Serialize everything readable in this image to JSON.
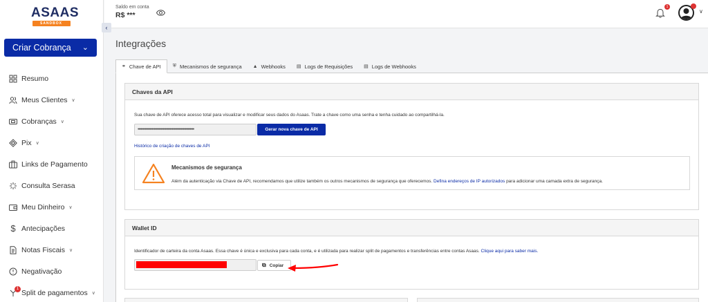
{
  "brand": {
    "name": "ASAAS",
    "badge": "SANDBOX"
  },
  "sidebar": {
    "create_button": "Criar Cobrança",
    "items": [
      {
        "label": "Resumo",
        "icon": "grid-icon",
        "has_chevron": false
      },
      {
        "label": "Meus Clientes",
        "icon": "users-icon",
        "has_chevron": true
      },
      {
        "label": "Cobranças",
        "icon": "ticket-icon",
        "has_chevron": true
      },
      {
        "label": "Pix",
        "icon": "pix-icon",
        "has_chevron": true
      },
      {
        "label": "Links de Pagamento",
        "icon": "link-box-icon",
        "has_chevron": false
      },
      {
        "label": "Consulta Serasa",
        "icon": "sparkle-icon",
        "has_chevron": false
      },
      {
        "label": "Meu Dinheiro",
        "icon": "wallet-icon",
        "has_chevron": true
      },
      {
        "label": "Antecipações",
        "icon": "dollar-icon",
        "has_chevron": false
      },
      {
        "label": "Notas Fiscais",
        "icon": "document-icon",
        "has_chevron": true
      },
      {
        "label": "Negativação",
        "icon": "negativation-icon",
        "has_chevron": false
      },
      {
        "label": "Split de pagamentos",
        "icon": "split-icon",
        "has_chevron": true,
        "badge": "1"
      }
    ]
  },
  "topbar": {
    "balance_label": "Saldo em conta",
    "balance_value": "R$ ***",
    "notification_badge": "1"
  },
  "main": {
    "title": "Integrações",
    "tabs": [
      {
        "label": "Chave de API",
        "icon": "key-icon",
        "active": true
      },
      {
        "label": "Mecanismos de segurança",
        "icon": "shield-icon",
        "active": false
      },
      {
        "label": "Webhooks",
        "icon": "bell-icon",
        "active": false
      },
      {
        "label": "Logs de Requisições",
        "icon": "log-icon",
        "active": false
      },
      {
        "label": "Logs de Webhooks",
        "icon": "log-icon",
        "active": false
      }
    ],
    "api_card": {
      "title": "Chaves da API",
      "description": "Sua chave de API oferece acesso total para visualizar e modificar seus dados do Asaas. Trate a chave como uma senha e tenha cuidado ao compartilhá-la.",
      "masked_key": "••••••••••••••••••••••••••••••••••••••••••••••••••••••••",
      "generate_button": "Gerar nova chave de API",
      "history_link": "Histórico de criação de chaves de API",
      "security": {
        "title": "Mecanismos de segurança",
        "text": "Além da autenticação via Chave de API, recomendamos que utilize também os outros mecanismos de segurança que oferecemos.",
        "link": "Defina endereços de IP autorizados",
        "text_after": "para adicionar uma camada extra de segurança."
      }
    },
    "wallet_card": {
      "title": "Wallet ID",
      "description": "Identificador de carteira da conta Asaas. Essa chave é única e exclusiva para cada conta, e é utilizada para realizar split de pagamentos e transferências entre contas Asaas.",
      "link": "Clique aqui para saber mais.",
      "copy_button": "Copiar"
    }
  },
  "colors": {
    "primary": "#0a2ba6",
    "accent": "#f58220",
    "warning": "#f58220",
    "annotation": "#ff0000"
  }
}
